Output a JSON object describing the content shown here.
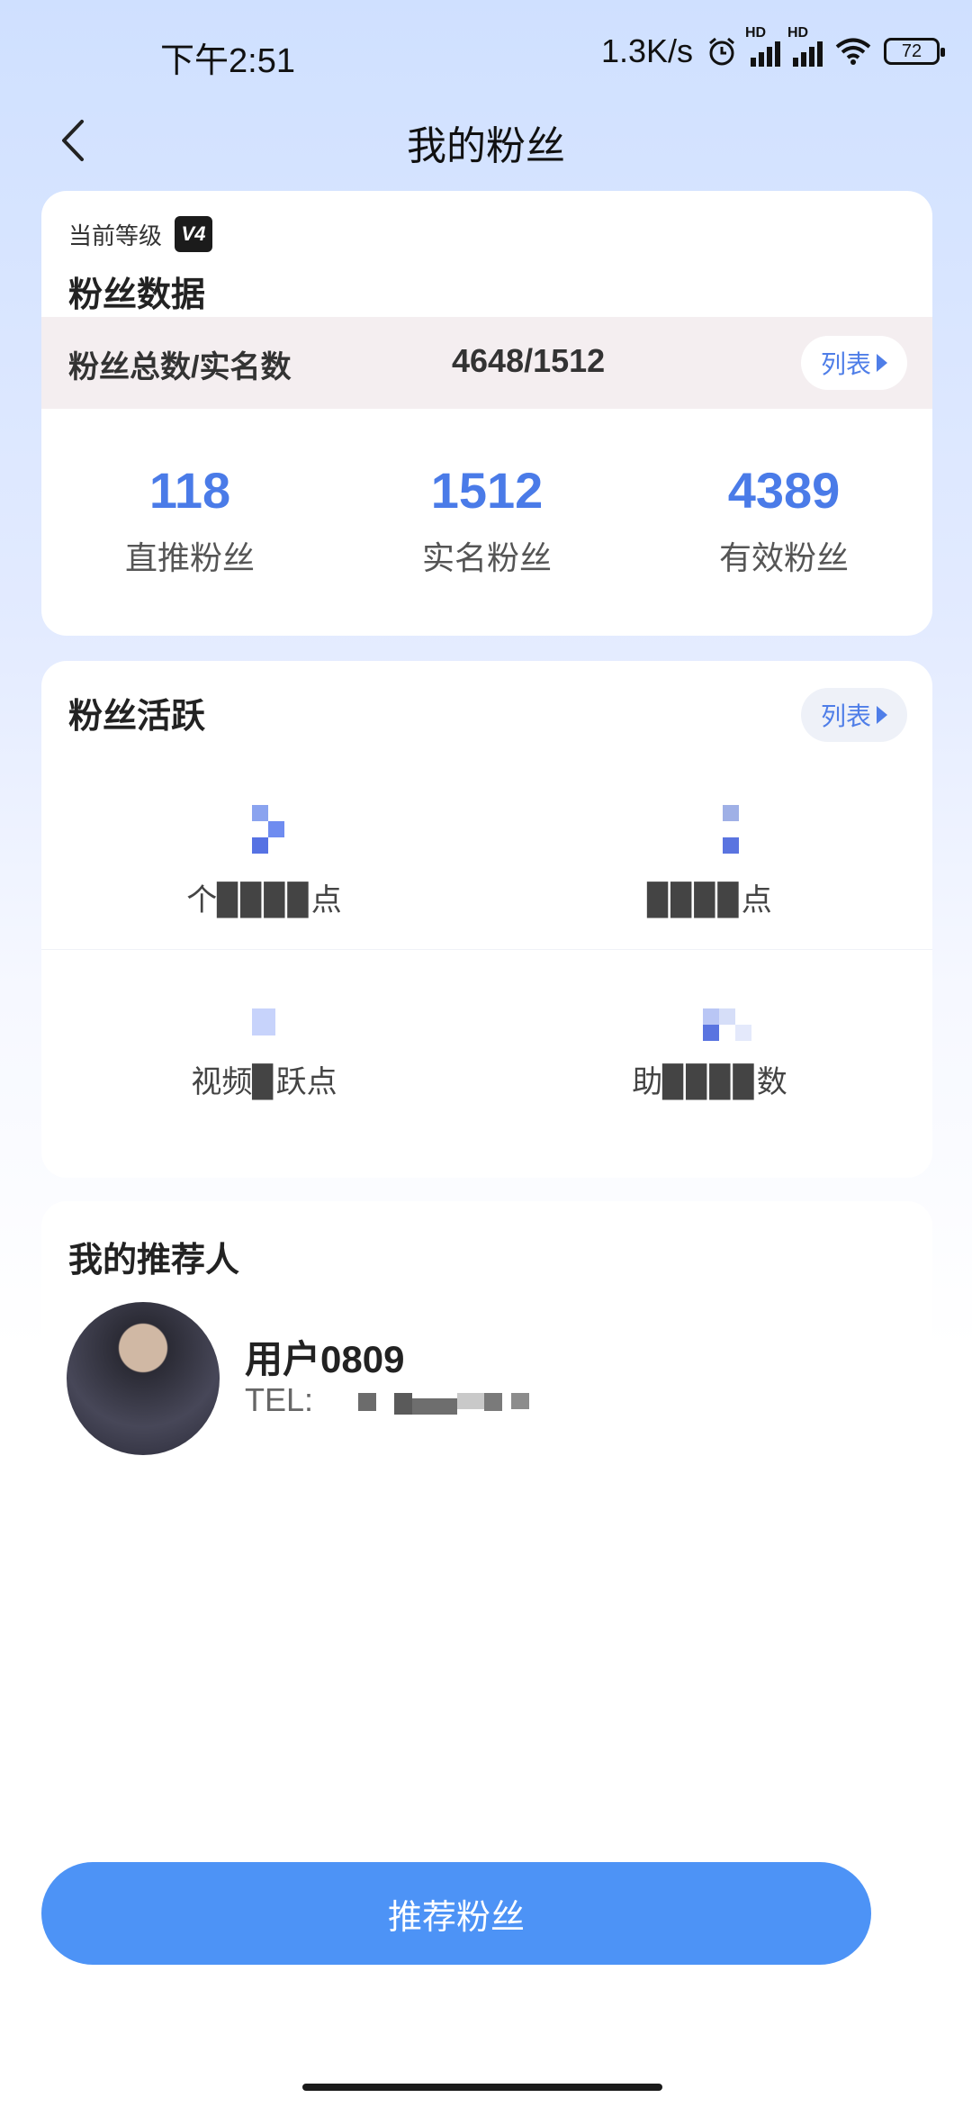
{
  "status_bar": {
    "time": "下午2:51",
    "network_speed": "1.3K/s",
    "hd": "HD",
    "battery": "72"
  },
  "header": {
    "title": "我的粉丝"
  },
  "fan_data": {
    "level_label": "当前等级",
    "level_badge": "V4",
    "title": "粉丝数据",
    "total_label": "粉丝总数/实名数",
    "total_value": "4648/1512",
    "list_button": "列表",
    "stats": [
      {
        "value": "118",
        "label": "直推粉丝"
      },
      {
        "value": "1512",
        "label": "实名粉丝"
      },
      {
        "value": "4389",
        "label": "有效粉丝"
      }
    ]
  },
  "fan_activity": {
    "title": "粉丝活跃",
    "list_button": "列表",
    "items": [
      {
        "label": "个▉▉▉▉点"
      },
      {
        "label": "▉▉▉▉点"
      },
      {
        "label": "视频▉跃点"
      },
      {
        "label": "助▉▉▉▉数"
      }
    ]
  },
  "recommender": {
    "title": "我的推荐人",
    "name": "用户0809",
    "tel_prefix": "TEL:"
  },
  "bottom_button": {
    "label": "推荐粉丝"
  },
  "colors": {
    "accent_blue": "#4a7be8",
    "button_blue": "#4d93f6",
    "total_row_bg": "#f4eef0"
  }
}
